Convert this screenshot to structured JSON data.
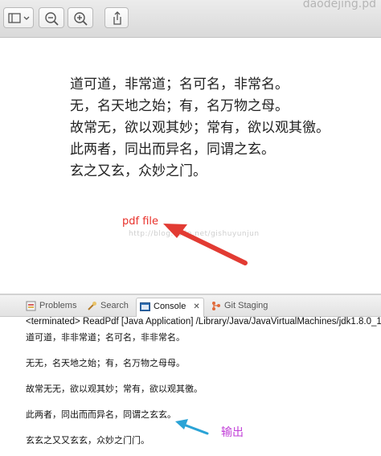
{
  "window": {
    "title": "daodejing.pd"
  },
  "toolbar": {
    "sidebar_icon": "sidebar-icon",
    "zoom_out_icon": "zoom-out-icon",
    "zoom_in_icon": "zoom-in-icon",
    "share_icon": "share-icon"
  },
  "document": {
    "lines": [
      "道可道，非常道；名可名，非常名。",
      "无，名天地之始；有，名万物之母。",
      "故常无，欲以观其妙；常有，欲以观其徼。",
      "此两者，同出而异名，同谓之玄。",
      "玄之又玄，众妙之门。"
    ]
  },
  "annotations": {
    "pdf_label": "pdf file",
    "pdf_color": "#e8302a",
    "output_label": "输出",
    "output_color": "#c13fd8",
    "watermark": "http://blog.csdn.net/gishuyunjun"
  },
  "eclipse": {
    "tabs": [
      {
        "label": "Problems",
        "icon": "problems-icon"
      },
      {
        "label": "Search",
        "icon": "search-icon"
      },
      {
        "label": "Console",
        "icon": "console-icon",
        "active": true
      },
      {
        "label": "Git Staging",
        "icon": "git-staging-icon"
      }
    ],
    "close_symbol": "✕",
    "terminated_line": "<terminated> ReadPdf [Java Application] /Library/Java/JavaVirtualMachines/jdk1.8.0_1",
    "output_lines": [
      "道可道，非非常道；名可名，非非常名。",
      "无无，名天地之始；有，名万物之母母。",
      "故常无无，欲以观其妙；常有，欲以观其徼。",
      "此两者，同出而而异名，同谓之玄玄。",
      "玄玄之又又玄玄，众妙之门门。"
    ]
  }
}
